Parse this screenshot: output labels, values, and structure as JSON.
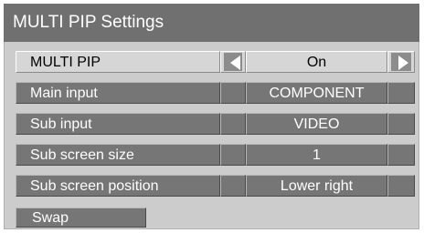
{
  "window": {
    "title": "MULTI PIP Settings"
  },
  "settings": [
    {
      "label": "MULTI PIP",
      "value": "On",
      "selected": true
    },
    {
      "label": "Main input",
      "value": "COMPONENT",
      "selected": false
    },
    {
      "label": "Sub input",
      "value": "VIDEO",
      "selected": false
    },
    {
      "label": "Sub screen size",
      "value": "1",
      "selected": false
    },
    {
      "label": "Sub screen position",
      "value": "Lower right",
      "selected": false
    }
  ],
  "actions": {
    "swap_label": "Swap"
  },
  "icons": {
    "left_arrow": "left-arrow-icon",
    "right_arrow": "right-arrow-icon"
  },
  "colors": {
    "title_bar": "#707070",
    "dialog_bg": "#cccccc",
    "cell_normal": "#767676",
    "cell_selected": "#d6d6d6",
    "text_normal": "#ffffff",
    "text_selected": "#000000"
  }
}
